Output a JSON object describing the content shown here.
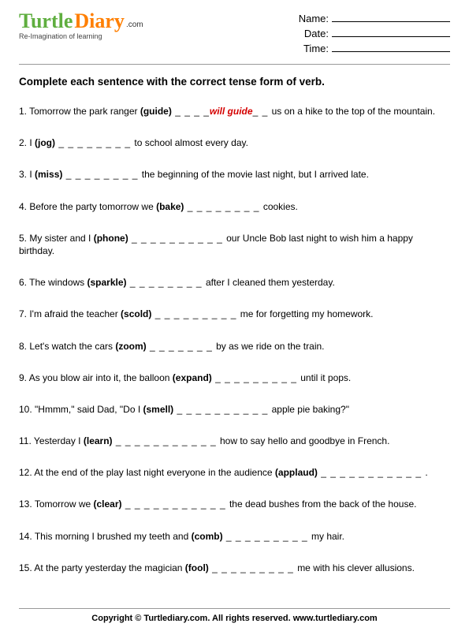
{
  "logo": {
    "word1": "Turtle",
    "word2": "Diary",
    "dotcom": ".com",
    "tagline": "Re-Imagination of learning"
  },
  "info": {
    "name_label": "Name:",
    "date_label": "Date:",
    "time_label": "Time:"
  },
  "instruction": "Complete each sentence with the correct tense form of verb.",
  "questions": [
    {
      "n": "1.",
      "pre": "Tomorrow the park ranger ",
      "verb": "(guide)",
      "blank": "  _ _ _ _",
      "ans": "will guide",
      "blank2": "_ _  ",
      "post": "us on a hike to the top of the mountain."
    },
    {
      "n": "2.",
      "pre": "I ",
      "verb": "(jog)",
      "blank": " _ _ _ _ _ _ _ _ ",
      "post": "to school almost every day."
    },
    {
      "n": "3.",
      "pre": "I ",
      "verb": "(miss)",
      "blank": " _ _ _ _ _ _ _ _   ",
      "post": "the beginning of the movie last night, but I arrived late."
    },
    {
      "n": "4.",
      "pre": "Before the party tomorrow we  ",
      "verb": "(bake)",
      "blank": " _ _ _ _ _ _ _ _  ",
      "post": "cookies."
    },
    {
      "n": "5.",
      "pre": "My sister and I  ",
      "verb": "(phone)",
      "blank": " _ _ _ _ _ _ _ _ _ _ ",
      "post": "our Uncle Bob last night to wish him a happy birthday."
    },
    {
      "n": "6.",
      "pre": "The windows  ",
      "verb": "(sparkle)",
      "blank": " _ _ _ _ _ _ _ _ ",
      "post": "after I cleaned them yesterday."
    },
    {
      "n": "7.",
      "pre": "I'm afraid the teacher  ",
      "verb": "(scold)",
      "blank": " _ _ _ _ _ _ _ _ _  ",
      "post": "me for forgetting my homework."
    },
    {
      "n": "8.",
      "pre": "Let's watch the cars  ",
      "verb": "(zoom)",
      "blank": " _ _ _ _ _ _ _   ",
      "post": "by as we ride on the train."
    },
    {
      "n": "9.",
      "pre": "As you blow air into it, the balloon ",
      "verb": "(expand)",
      "blank": " _ _ _ _ _ _ _ _ _  ",
      "post": "until it pops."
    },
    {
      "n": "10.",
      "pre": "\"Hmmm,\" said Dad, \"Do I ",
      "verb": "(smell)",
      "blank": "  _ _ _ _ _ _ _ _ _ _   ",
      "post": "apple pie baking?\""
    },
    {
      "n": "11.",
      "pre": "Yesterday I ",
      "verb": "(learn)",
      "blank": " _ _ _ _ _ _ _ _ _ _ _  ",
      "post": "how to say hello and goodbye in French."
    },
    {
      "n": "12.",
      "pre": "At the end of the play last night everyone in the audience ",
      "verb": "(applaud)",
      "blank": " _ _ _ _ _ _ _ _ _ _ _  ",
      "post": "."
    },
    {
      "n": "13.",
      "pre": "Tomorrow we ",
      "verb": "(clear)",
      "blank": " _ _ _ _ _ _ _ _ _ _ _ ",
      "post": "the dead bushes from the back of the house."
    },
    {
      "n": "14.",
      "pre": "This morning I brushed my teeth and ",
      "verb": "(comb)",
      "blank": " _ _ _ _ _ _ _ _ _  ",
      "post": "my hair."
    },
    {
      "n": "15.",
      "pre": "At the party yesterday the magician ",
      "verb": "(fool)",
      "blank": " _ _ _ _ _ _ _ _ _ ",
      "post": "me with his clever allusions."
    }
  ],
  "footer": "Copyright © Turtlediary.com. All rights reserved. www.turtlediary.com"
}
